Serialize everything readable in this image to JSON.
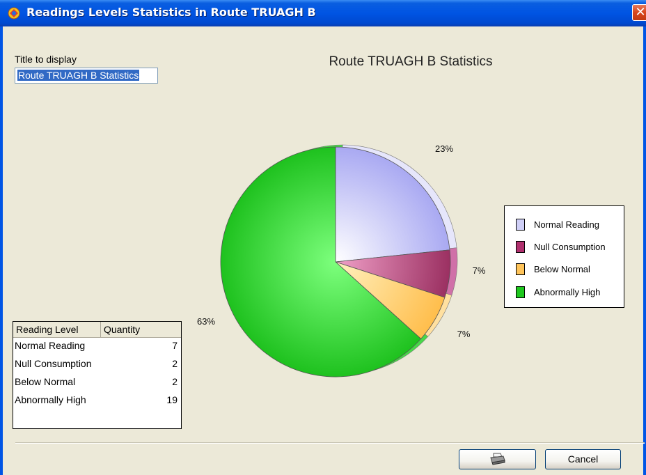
{
  "window": {
    "title": "Readings Levels Statistics in Route TRUAGH B",
    "close_symbol": "✕",
    "app_icon": "app-logo-icon"
  },
  "form": {
    "title_label": "Title to display",
    "title_value": "Route TRUAGH B Statistics"
  },
  "table": {
    "headers": [
      "Reading Level",
      "Quantity"
    ],
    "rows": [
      {
        "level": "Normal Reading",
        "qty": "7"
      },
      {
        "level": "Null Consumption",
        "qty": "2"
      },
      {
        "level": "Below Normal",
        "qty": "2"
      },
      {
        "level": "Abnormally High",
        "qty": "19"
      }
    ]
  },
  "buttons": {
    "print_icon": "printer-icon",
    "cancel_label": "Cancel"
  },
  "colors": {
    "titlebar": "#0054e3",
    "normal_reading": "#b5b5f5",
    "null_consumption": "#b0306e",
    "below_normal": "#ffc45a",
    "abnormally_high": "#1ec81e"
  },
  "chart_data": {
    "type": "pie",
    "title": "Route TRUAGH B Statistics",
    "categories": [
      "Normal Reading",
      "Null Consumption",
      "Below Normal",
      "Abnormally High"
    ],
    "values": [
      7,
      2,
      2,
      19
    ],
    "percent_labels": [
      "23%",
      "7%",
      "7%",
      "63%"
    ],
    "colors": [
      "#b5b5f5",
      "#b0306e",
      "#ffc45a",
      "#1ec81e"
    ],
    "legend_position": "right",
    "style": "3d-pie"
  }
}
